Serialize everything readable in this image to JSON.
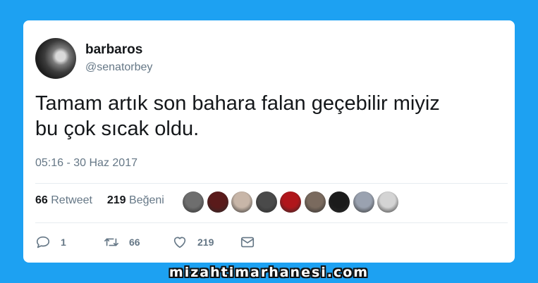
{
  "tweet": {
    "author_name": "barbaros",
    "author_handle": "@senatorbey",
    "text": "Tamam artık son bahara falan geçebilir miyiz\nbu çok sıcak oldu.",
    "timestamp": "05:16 - 30 Haz 2017"
  },
  "stats": {
    "retweet_count": "66",
    "retweet_label": "Retweet",
    "like_count": "219",
    "like_label": "Beğeni"
  },
  "likers": [
    {
      "color": "#6e6e6e"
    },
    {
      "color": "#5a1a1a"
    },
    {
      "color": "#c8b6a8"
    },
    {
      "color": "#4a4a4a"
    },
    {
      "color": "#b0161b"
    },
    {
      "color": "#7a6a5e"
    },
    {
      "color": "#1b1b1b"
    },
    {
      "color": "#9aa2b0"
    },
    {
      "color": "#d4d4d4"
    }
  ],
  "actions": {
    "reply_count": "1",
    "retweet_count": "66",
    "like_count": "219"
  },
  "icons": [
    "reply-icon",
    "retweet-icon",
    "like-icon",
    "message-icon"
  ],
  "colors": {
    "background": "#1da1f2",
    "text": "#14171a",
    "muted": "#657786"
  },
  "watermark": "mizahtimarhanesi.com"
}
